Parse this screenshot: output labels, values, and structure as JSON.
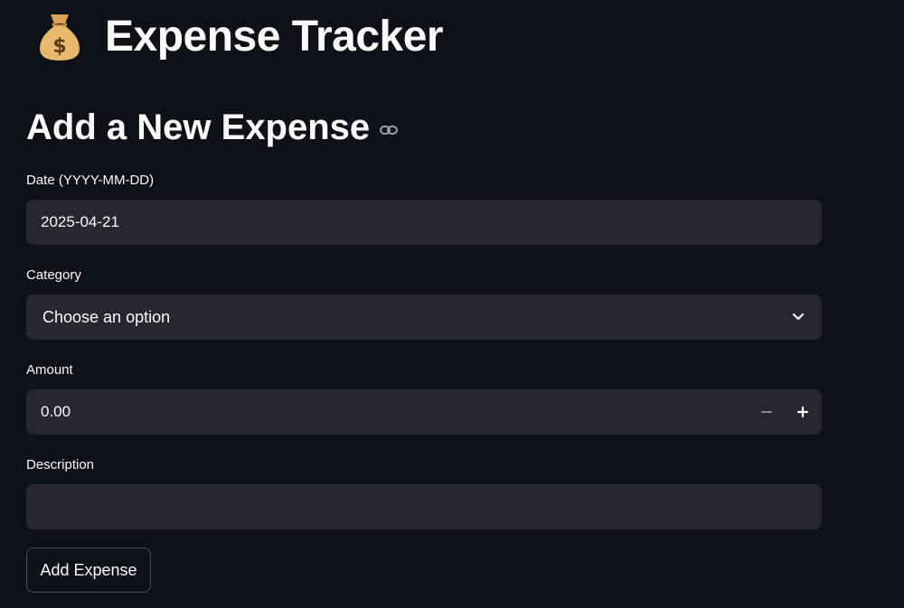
{
  "app": {
    "icon": "money-bag-icon",
    "title": "Expense Tracker"
  },
  "section": {
    "title": "Add a New Expense",
    "anchor_icon": "link-icon"
  },
  "form": {
    "date": {
      "label": "Date (YYYY-MM-DD)",
      "value": "2025-04-21"
    },
    "category": {
      "label": "Category",
      "selected": "Choose an option",
      "icon": "chevron-down-icon"
    },
    "amount": {
      "label": "Amount",
      "value": "0.00",
      "decrement_icon": "minus-icon",
      "increment_icon": "plus-icon"
    },
    "description": {
      "label": "Description",
      "value": ""
    },
    "submit_label": "Add Expense"
  },
  "colors": {
    "background": "#0e1117",
    "input_background": "#262730",
    "text": "#fafafa",
    "bag": "#e8b86d"
  }
}
